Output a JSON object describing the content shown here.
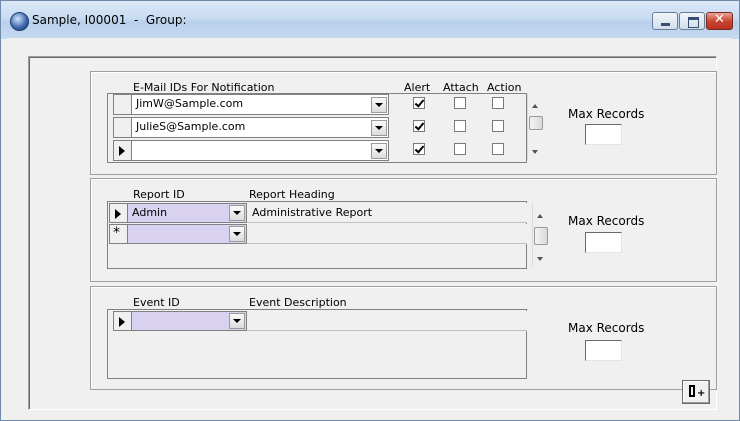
{
  "window": {
    "title": "Sample, I00001  -  Group:"
  },
  "panel1": {
    "headers": {
      "email": "E-Mail IDs For Notification",
      "alert": "Alert",
      "attach": "Attach",
      "action": "Action"
    },
    "rows": [
      {
        "email": "JimW@Sample.com",
        "alert": true,
        "attach": false,
        "action": false
      },
      {
        "email": "JulieS@Sample.com",
        "alert": true,
        "attach": false,
        "action": false
      },
      {
        "email": "",
        "alert": true,
        "attach": false,
        "action": false
      }
    ],
    "max_label": "Max Records",
    "max_value": ""
  },
  "panel2": {
    "headers": {
      "id": "Report ID",
      "heading": "Report Heading"
    },
    "rows": [
      {
        "id": "Admin",
        "heading": "Administrative Report"
      }
    ],
    "new_row": {
      "id": "",
      "heading": ""
    },
    "max_label": "Max Records",
    "max_value": ""
  },
  "panel3": {
    "headers": {
      "id": "Event ID",
      "desc": "Event Description"
    },
    "rows": [
      {
        "id": "",
        "desc": ""
      }
    ],
    "max_label": "Max Records",
    "max_value": ""
  },
  "icons": {
    "app": "app-globe-icon",
    "exit": "exit-door-icon"
  }
}
